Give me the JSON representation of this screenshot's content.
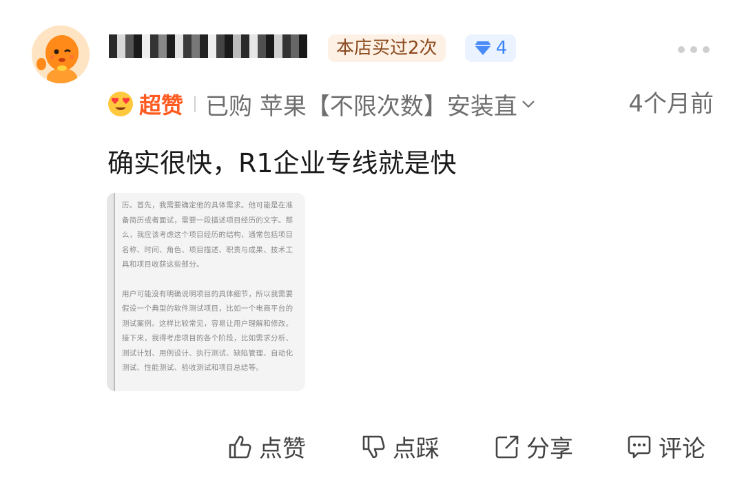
{
  "review": {
    "username_masked": "用户名已打码",
    "bought_badge": "本店买过2次",
    "level_badge": "4",
    "rating_label": "超赞",
    "purchase_info": "已购 苹果【不限次数】安装直",
    "time": "4个月前",
    "comment": "确实很快，R1企业专线就是快"
  },
  "photo": {
    "paragraph1": "历。首先，我需要确定他的具体需求。他可能是在准备简历或者面试，需要一段描述项目经历的文字。那么，我应该考虑这个项目经历的结构，通常包括项目名称、时间、角色、项目描述、职责与成果、技术工具和项目收获这些部分。",
    "paragraph2": "用户可能没有明确说明项目的具体细节，所以我需要假设一个典型的软件测试项目，比如一个电商平台的测试案例。这样比较常见，容易让用户理解和修改。接下来，我得考虑项目的各个阶段，比如需求分析、测试计划、用例设计、执行测试、缺陷管理、自动化测试、性能测试、验收测试和项目总结等。"
  },
  "actions": {
    "like": "点赞",
    "dislike": "点踩",
    "share": "分享",
    "comment": "评论"
  },
  "colors": {
    "accent": "#ff5a1f",
    "bought_badge_bg": "#fdf0e4",
    "level_badge_bg": "#eaf3ff",
    "level_blue": "#3b82f6"
  }
}
